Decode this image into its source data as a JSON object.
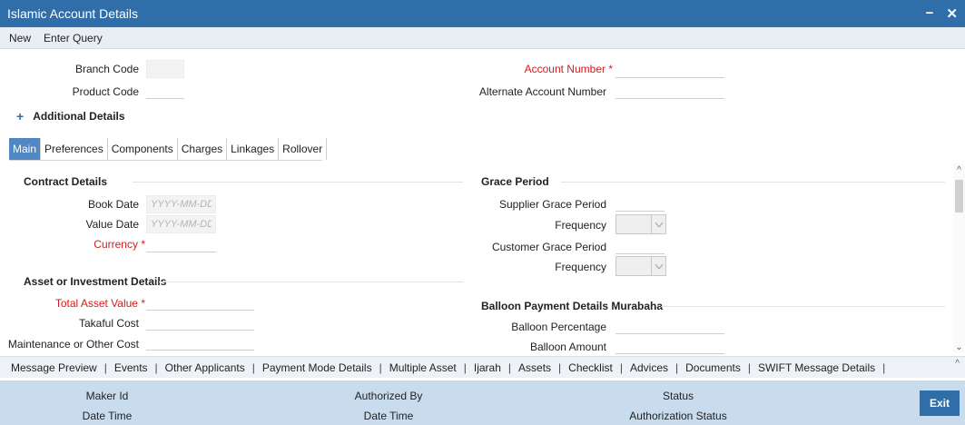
{
  "window": {
    "title": "Islamic Account Details",
    "minimize": "−",
    "close": "✕"
  },
  "menu": {
    "new": "New",
    "enter_query": "Enter Query"
  },
  "header": {
    "branch_code_label": "Branch Code",
    "product_code_label": "Product Code",
    "account_number_label": "Account Number",
    "alternate_account_label": "Alternate Account Number",
    "required_mark": "*"
  },
  "additional_details": {
    "icon": "plus-icon",
    "label": "Additional Details"
  },
  "tabs": [
    "Main",
    "Preferences",
    "Components",
    "Charges",
    "Linkages",
    "Rollover"
  ],
  "contract": {
    "heading": "Contract Details",
    "book_date_label": "Book Date",
    "value_date_label": "Value Date",
    "currency_label": "Currency",
    "date_placeholder": "YYYY-MM-DD"
  },
  "asset": {
    "heading": "Asset or Investment Details",
    "total_asset_value_label": "Total Asset Value",
    "takaful_cost_label": "Takaful Cost",
    "maintenance_cost_label": "Maintenance or Other Cost"
  },
  "grace": {
    "heading": "Grace Period",
    "supplier_label": "Supplier Grace Period",
    "frequency_label": "Frequency",
    "customer_label": "Customer Grace Period"
  },
  "balloon": {
    "heading": "Balloon Payment Details Murabaha",
    "percentage_label": "Balloon Percentage",
    "amount_label": "Balloon Amount"
  },
  "links": [
    "Message Preview",
    "Events",
    "Other Applicants",
    "Payment Mode Details",
    "Multiple Asset",
    "Ijarah",
    "Assets",
    "Checklist",
    "Advices",
    "Documents",
    "SWIFT Message Details"
  ],
  "link_separator": "|",
  "footer": {
    "maker_id": "Maker Id",
    "date_time": "Date Time",
    "authorized_by": "Authorized By",
    "status": "Status",
    "authorization_status": "Authorization Status",
    "exit": "Exit"
  },
  "colors": {
    "titlebar": "#2f6ea8",
    "active_tab": "#5187c2",
    "required": "#d01c1c",
    "footer": "#c8dcee"
  }
}
